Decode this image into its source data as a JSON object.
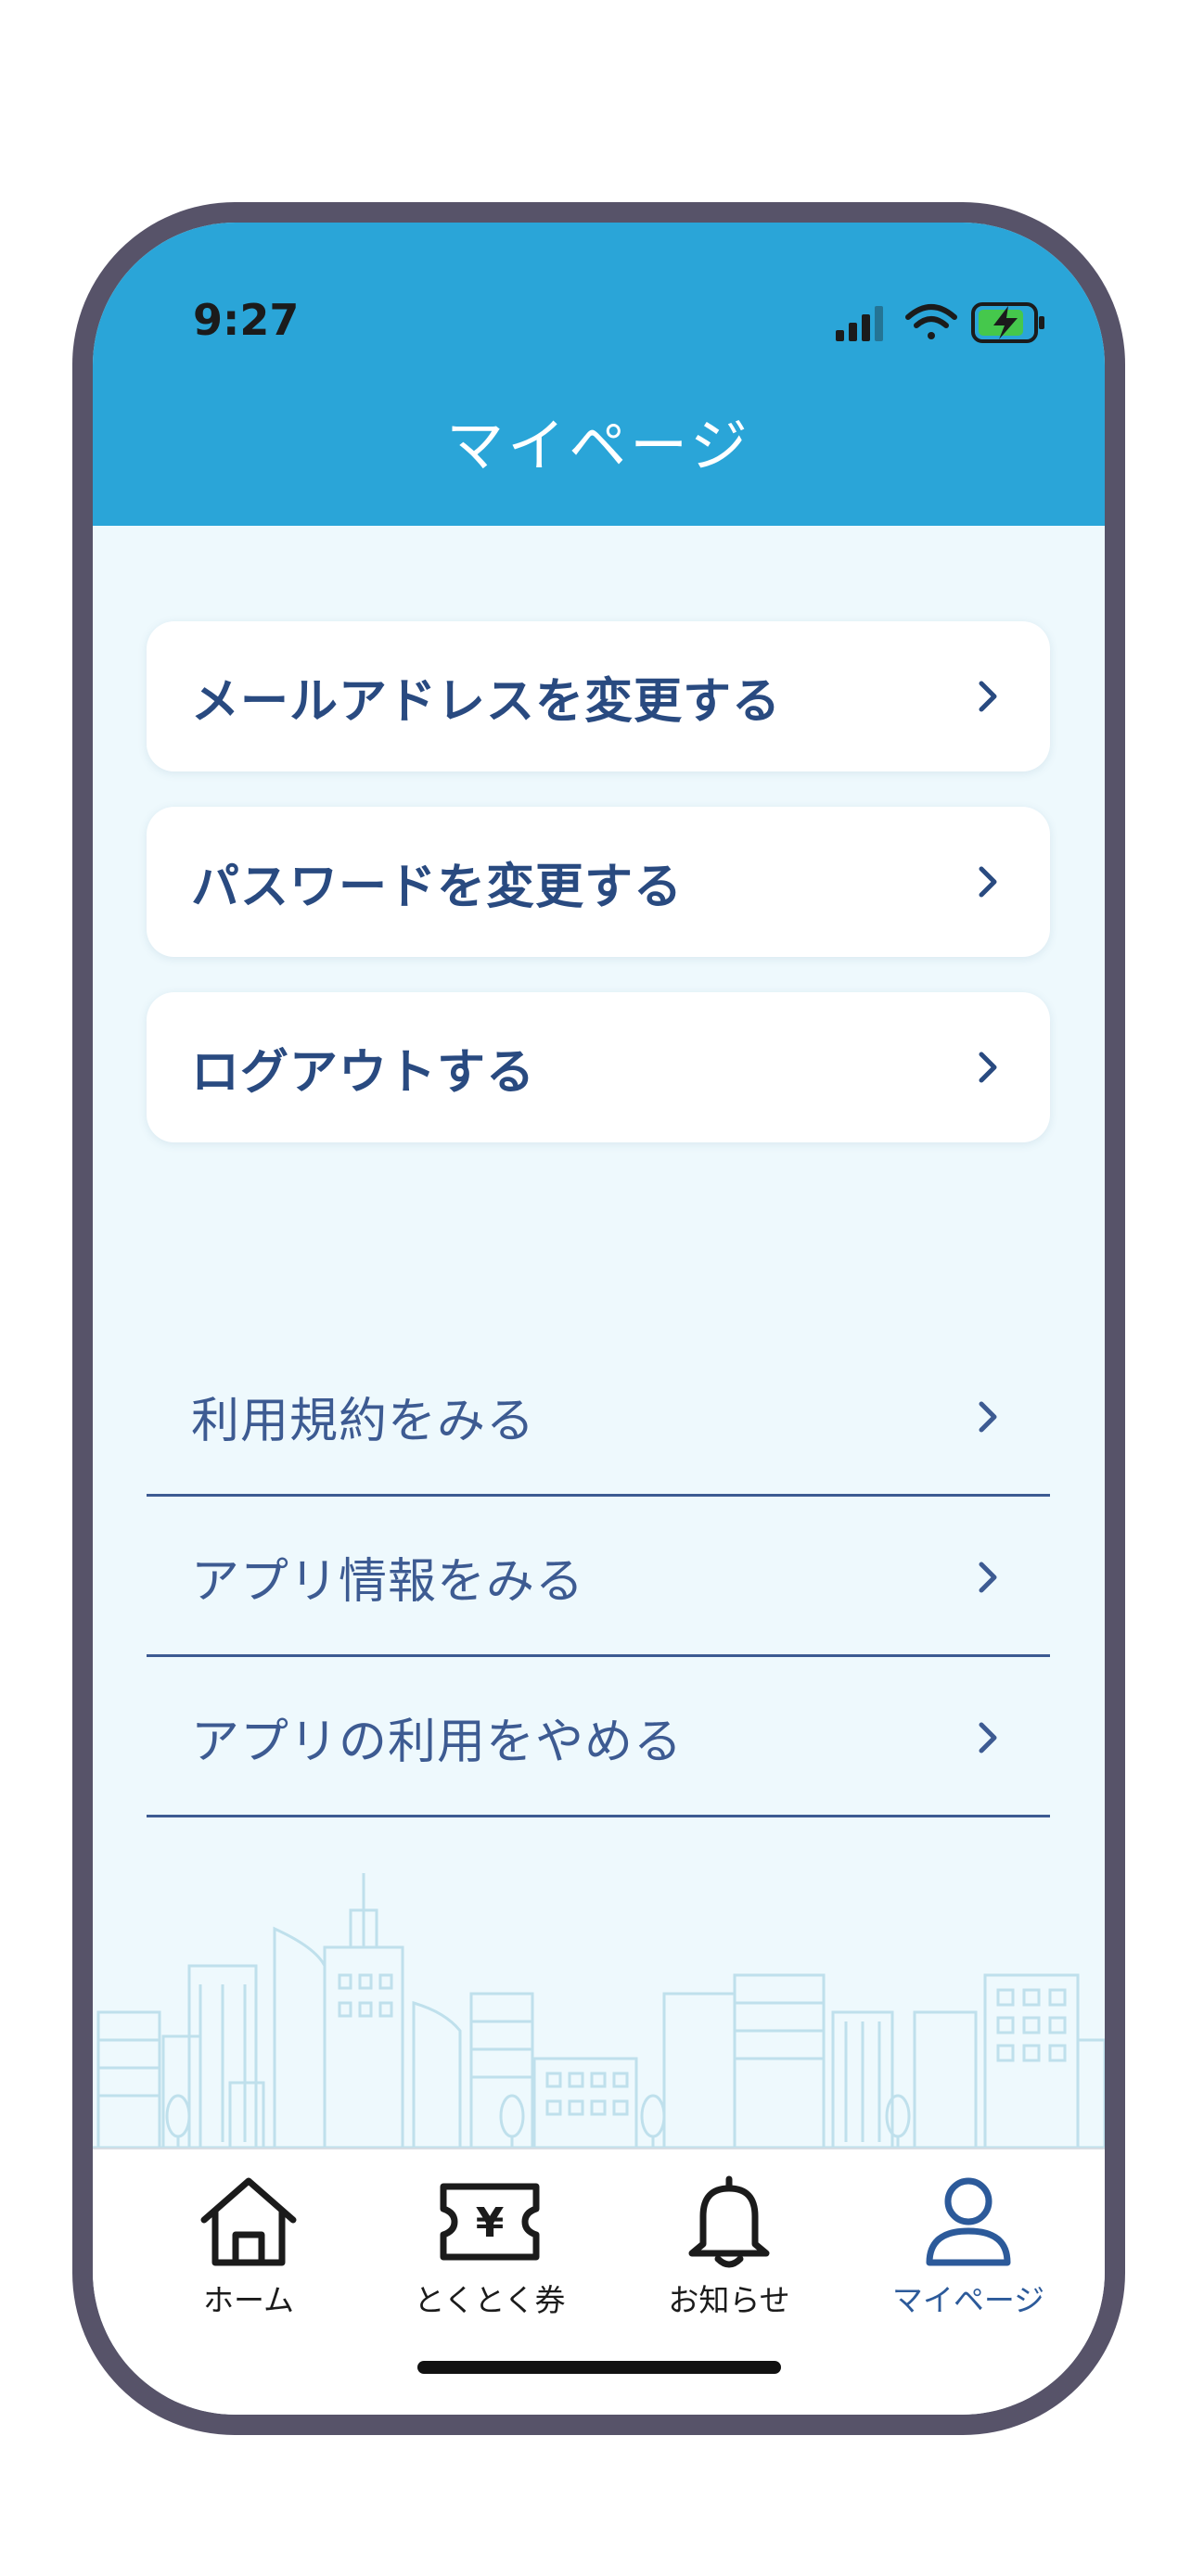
{
  "status_bar": {
    "time": "9:27"
  },
  "header": {
    "title": "マイページ"
  },
  "menu_cards": [
    {
      "label": "メールアドレスを変更する"
    },
    {
      "label": "パスワードを変更する"
    },
    {
      "label": "ログアウトする"
    }
  ],
  "menu_rows": [
    {
      "label": "利用規約をみる"
    },
    {
      "label": "アプリ情報をみる"
    },
    {
      "label": "アプリの利用をやめる"
    }
  ],
  "tabbar": {
    "tabs": [
      {
        "label": "ホーム",
        "icon": "home-icon"
      },
      {
        "label": "とくとく券",
        "icon": "yen-ticket-icon"
      },
      {
        "label": "お知らせ",
        "icon": "bell-icon"
      },
      {
        "label": "マイページ",
        "icon": "person-icon"
      }
    ],
    "active_index": 3
  },
  "colors": {
    "header_bg": "#2aa5d8",
    "content_bg": "#eef9fd",
    "card_text": "#294a80",
    "row_text": "#3d5b92",
    "active_tab": "#2c5a9a",
    "phone_frame": "#575369"
  }
}
